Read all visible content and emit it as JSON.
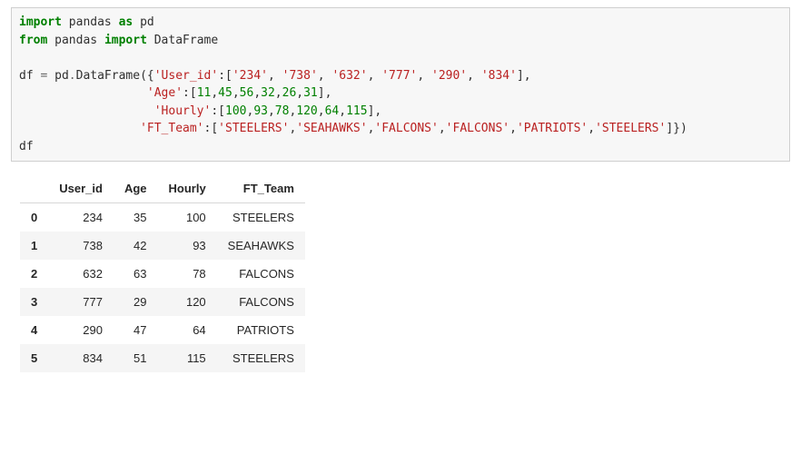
{
  "code": {
    "t_import": "import",
    "t_pandas": "pandas",
    "t_as": "as",
    "t_pd": "pd",
    "t_from": "from",
    "t_DataFrame": "DataFrame",
    "t_df": "df",
    "t_eq": "=",
    "t_dot": ".",
    "t_DataFrameCall": "DataFrame",
    "t_lparen": "(",
    "t_rparen": ")",
    "t_lbrace": "{",
    "t_rbrace": "}",
    "t_lbracket": "[",
    "t_rbracket": "]",
    "t_colon": ":",
    "t_comma": ",",
    "k_userid": "'User_id'",
    "v_u0": "'234'",
    "v_u1": "'738'",
    "v_u2": "'632'",
    "v_u3": "'777'",
    "v_u4": "'290'",
    "v_u5": "'834'",
    "k_age": "'Age'",
    "v_a0": "11",
    "v_a1": "45",
    "v_a2": "56",
    "v_a3": "32",
    "v_a4": "26",
    "v_a5": "31",
    "k_hourly": "'Hourly'",
    "v_h0": "100",
    "v_h1": "93",
    "v_h2": "78",
    "v_h3": "120",
    "v_h4": "64",
    "v_h5": "115",
    "k_ftteam": "'FT_Team'",
    "v_t0": "'STEELERS'",
    "v_t1": "'SEAHAWKS'",
    "v_t2": "'FALCONS'",
    "v_t3": "'FALCONS'",
    "v_t4": "'PATRIOTS'",
    "v_t5": "'STEELERS'",
    "t_dfExpr": "df"
  },
  "table": {
    "headers": [
      "User_id",
      "Age",
      "Hourly",
      "FT_Team"
    ],
    "rows": [
      {
        "idx": "0",
        "User_id": "234",
        "Age": "35",
        "Hourly": "100",
        "FT_Team": "STEELERS"
      },
      {
        "idx": "1",
        "User_id": "738",
        "Age": "42",
        "Hourly": "93",
        "FT_Team": "SEAHAWKS"
      },
      {
        "idx": "2",
        "User_id": "632",
        "Age": "63",
        "Hourly": "78",
        "FT_Team": "FALCONS"
      },
      {
        "idx": "3",
        "User_id": "777",
        "Age": "29",
        "Hourly": "120",
        "FT_Team": "FALCONS"
      },
      {
        "idx": "4",
        "User_id": "290",
        "Age": "47",
        "Hourly": "64",
        "FT_Team": "PATRIOTS"
      },
      {
        "idx": "5",
        "User_id": "834",
        "Age": "51",
        "Hourly": "115",
        "FT_Team": "STEELERS"
      }
    ]
  }
}
